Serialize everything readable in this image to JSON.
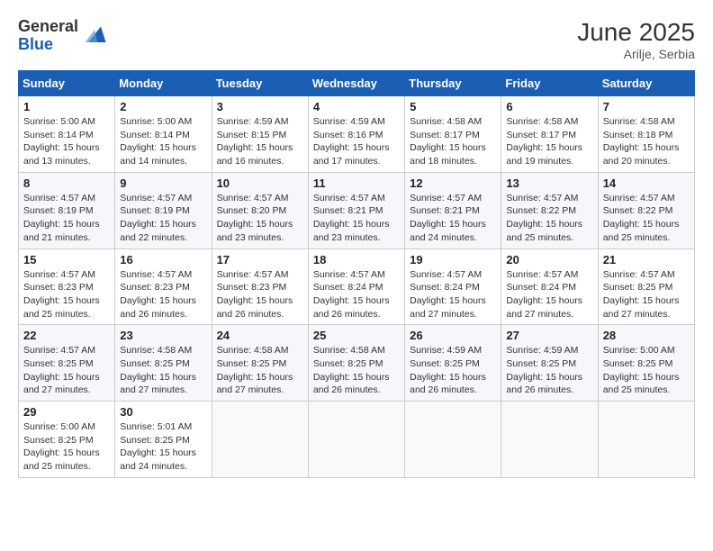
{
  "header": {
    "logo_general": "General",
    "logo_blue": "Blue",
    "title": "June 2025",
    "location": "Arilje, Serbia"
  },
  "calendar": {
    "days_of_week": [
      "Sunday",
      "Monday",
      "Tuesday",
      "Wednesday",
      "Thursday",
      "Friday",
      "Saturday"
    ],
    "weeks": [
      [
        null,
        {
          "day": "2",
          "sunrise": "5:00 AM",
          "sunset": "8:14 PM",
          "daylight": "15 hours and 14 minutes."
        },
        {
          "day": "3",
          "sunrise": "4:59 AM",
          "sunset": "8:15 PM",
          "daylight": "15 hours and 16 minutes."
        },
        {
          "day": "4",
          "sunrise": "4:59 AM",
          "sunset": "8:16 PM",
          "daylight": "15 hours and 17 minutes."
        },
        {
          "day": "5",
          "sunrise": "4:58 AM",
          "sunset": "8:17 PM",
          "daylight": "15 hours and 18 minutes."
        },
        {
          "day": "6",
          "sunrise": "4:58 AM",
          "sunset": "8:17 PM",
          "daylight": "15 hours and 19 minutes."
        },
        {
          "day": "7",
          "sunrise": "4:58 AM",
          "sunset": "8:18 PM",
          "daylight": "15 hours and 20 minutes."
        }
      ],
      [
        {
          "day": "8",
          "sunrise": "4:57 AM",
          "sunset": "8:19 PM",
          "daylight": "15 hours and 21 minutes."
        },
        {
          "day": "9",
          "sunrise": "4:57 AM",
          "sunset": "8:19 PM",
          "daylight": "15 hours and 22 minutes."
        },
        {
          "day": "10",
          "sunrise": "4:57 AM",
          "sunset": "8:20 PM",
          "daylight": "15 hours and 23 minutes."
        },
        {
          "day": "11",
          "sunrise": "4:57 AM",
          "sunset": "8:21 PM",
          "daylight": "15 hours and 23 minutes."
        },
        {
          "day": "12",
          "sunrise": "4:57 AM",
          "sunset": "8:21 PM",
          "daylight": "15 hours and 24 minutes."
        },
        {
          "day": "13",
          "sunrise": "4:57 AM",
          "sunset": "8:22 PM",
          "daylight": "15 hours and 25 minutes."
        },
        {
          "day": "14",
          "sunrise": "4:57 AM",
          "sunset": "8:22 PM",
          "daylight": "15 hours and 25 minutes."
        }
      ],
      [
        {
          "day": "15",
          "sunrise": "4:57 AM",
          "sunset": "8:23 PM",
          "daylight": "15 hours and 25 minutes."
        },
        {
          "day": "16",
          "sunrise": "4:57 AM",
          "sunset": "8:23 PM",
          "daylight": "15 hours and 26 minutes."
        },
        {
          "day": "17",
          "sunrise": "4:57 AM",
          "sunset": "8:23 PM",
          "daylight": "15 hours and 26 minutes."
        },
        {
          "day": "18",
          "sunrise": "4:57 AM",
          "sunset": "8:24 PM",
          "daylight": "15 hours and 26 minutes."
        },
        {
          "day": "19",
          "sunrise": "4:57 AM",
          "sunset": "8:24 PM",
          "daylight": "15 hours and 27 minutes."
        },
        {
          "day": "20",
          "sunrise": "4:57 AM",
          "sunset": "8:24 PM",
          "daylight": "15 hours and 27 minutes."
        },
        {
          "day": "21",
          "sunrise": "4:57 AM",
          "sunset": "8:25 PM",
          "daylight": "15 hours and 27 minutes."
        }
      ],
      [
        {
          "day": "22",
          "sunrise": "4:57 AM",
          "sunset": "8:25 PM",
          "daylight": "15 hours and 27 minutes."
        },
        {
          "day": "23",
          "sunrise": "4:58 AM",
          "sunset": "8:25 PM",
          "daylight": "15 hours and 27 minutes."
        },
        {
          "day": "24",
          "sunrise": "4:58 AM",
          "sunset": "8:25 PM",
          "daylight": "15 hours and 27 minutes."
        },
        {
          "day": "25",
          "sunrise": "4:58 AM",
          "sunset": "8:25 PM",
          "daylight": "15 hours and 26 minutes."
        },
        {
          "day": "26",
          "sunrise": "4:59 AM",
          "sunset": "8:25 PM",
          "daylight": "15 hours and 26 minutes."
        },
        {
          "day": "27",
          "sunrise": "4:59 AM",
          "sunset": "8:25 PM",
          "daylight": "15 hours and 26 minutes."
        },
        {
          "day": "28",
          "sunrise": "5:00 AM",
          "sunset": "8:25 PM",
          "daylight": "15 hours and 25 minutes."
        }
      ],
      [
        {
          "day": "29",
          "sunrise": "5:00 AM",
          "sunset": "8:25 PM",
          "daylight": "15 hours and 25 minutes."
        },
        {
          "day": "30",
          "sunrise": "5:01 AM",
          "sunset": "8:25 PM",
          "daylight": "15 hours and 24 minutes."
        },
        null,
        null,
        null,
        null,
        null
      ]
    ],
    "week1_sunday": {
      "day": "1",
      "sunrise": "5:00 AM",
      "sunset": "8:14 PM",
      "daylight": "15 hours and 13 minutes."
    }
  }
}
